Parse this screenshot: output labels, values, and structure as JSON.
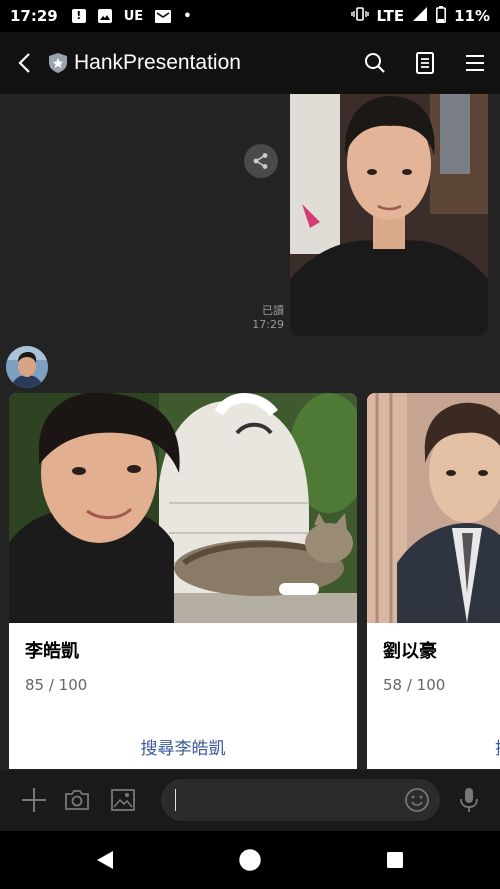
{
  "status_bar": {
    "time": "17:29",
    "indicator_ue": "UE",
    "network": "LTE",
    "battery": "11%"
  },
  "header": {
    "title": "HankPresentation"
  },
  "chat": {
    "read_label": "已讀",
    "read_time": "17:29"
  },
  "cards": [
    {
      "name": "李皓凱",
      "score": "85 / 100",
      "link": "搜尋李皓凱"
    },
    {
      "name": "劉以豪",
      "score": "58 / 100",
      "link": "搜"
    }
  ],
  "colors": {
    "header_bg": "#111111",
    "chat_bg": "#232323",
    "card_bg": "#ffffff",
    "link": "#3a5a9a",
    "inputbar_bg": "#1a1a1a"
  }
}
